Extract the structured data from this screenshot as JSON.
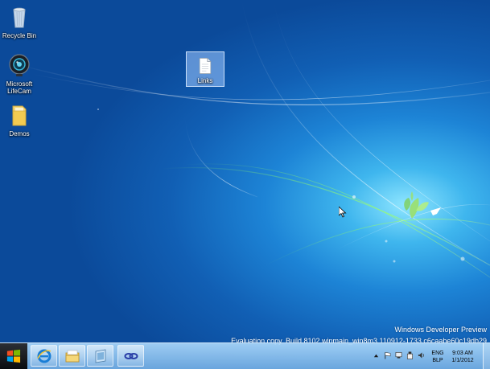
{
  "desktop": {
    "icons": [
      {
        "label": "Recycle Bin",
        "icon": "recycle-bin-icon"
      },
      {
        "label": "Microsoft LifeCam",
        "icon": "webcam-icon"
      },
      {
        "label": "Demos",
        "icon": "folder-icon"
      },
      {
        "label": "Links",
        "icon": "text-file-icon",
        "selected": true
      }
    ],
    "watermark": {
      "title": "Windows Developer Preview",
      "build": "Evaluation copy. Build 8102.winmain_win8m3.110912-1733.c6caabe60c19db29"
    }
  },
  "taskbar": {
    "pinned": [
      {
        "name": "internet-explorer",
        "icon": "internet-explorer-icon"
      },
      {
        "name": "windows-explorer",
        "icon": "file-explorer-icon"
      },
      {
        "name": "app",
        "icon": "app-window-icon"
      },
      {
        "name": "link-app",
        "icon": "link-icon"
      }
    ],
    "tray": {
      "language": "ENG",
      "layout": "BLP",
      "time": "9:03 AM",
      "date": "1/1/2012"
    }
  },
  "colors": {
    "desktop_blue": "#1d84d6",
    "glow": "#8fe6ff",
    "taskbar": "#8ec3ef"
  }
}
